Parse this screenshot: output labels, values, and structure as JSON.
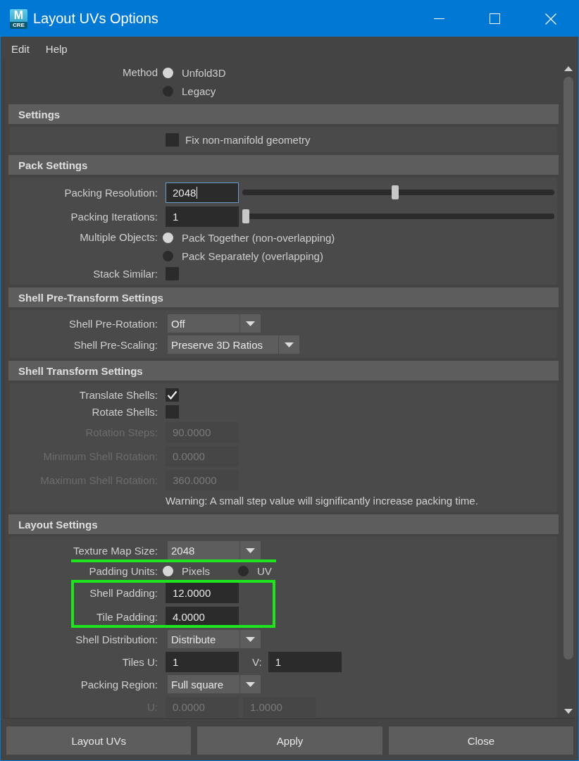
{
  "window": {
    "title": "Layout UVs Options",
    "logo": {
      "letter": "M",
      "badge": "CRE"
    }
  },
  "menu": [
    {
      "label": "Edit"
    },
    {
      "label": "Help"
    }
  ],
  "sections": [
    {
      "rows": [
        {
          "kind": "radio",
          "label": "Method",
          "options": [
            {
              "label": "Unfold3D",
              "selected": true
            },
            {
              "label": "Legacy",
              "selected": false
            }
          ]
        }
      ]
    },
    {
      "title": "Settings",
      "rows": [
        {
          "kind": "checkbox",
          "text": "Fix non-manifold geometry",
          "checked": false
        }
      ]
    },
    {
      "title": "Pack Settings",
      "rows": [
        {
          "kind": "slider",
          "label": "Packing Resolution:",
          "value": "2048",
          "focused": true,
          "level": 0.49
        },
        {
          "kind": "slider",
          "label": "Packing Iterations:",
          "value": "1",
          "focused": false,
          "level": 0
        },
        {
          "kind": "radio",
          "label": "Multiple Objects:",
          "options": [
            {
              "label": "Pack Together (non-overlapping)",
              "selected": true
            },
            {
              "label": "Pack Separately (overlapping)",
              "selected": false
            }
          ]
        },
        {
          "kind": "checkbox",
          "label": "Stack Similar:",
          "checked": false
        }
      ]
    },
    {
      "title": "Shell Pre-Transform Settings",
      "rows": [
        {
          "kind": "dropdown",
          "label": "Shell Pre-Rotation:",
          "value": "Off"
        },
        {
          "kind": "dropdown",
          "label": "Shell Pre-Scaling:",
          "value": "Preserve 3D Ratios"
        }
      ]
    },
    {
      "title": "Shell Transform Settings",
      "rows": [
        {
          "kind": "checkbox",
          "label": "Translate Shells:",
          "checked": true
        },
        {
          "kind": "checkbox",
          "label": "Rotate Shells:",
          "checked": false
        },
        {
          "kind": "fields",
          "label": "Rotation Steps:",
          "disabled": true,
          "fields": [
            {
              "value": "90.0000"
            }
          ]
        },
        {
          "kind": "fields",
          "label": "Minimum Shell Rotation:",
          "disabled": true,
          "fields": [
            {
              "value": "0.0000"
            }
          ]
        },
        {
          "kind": "fields",
          "label": "Maximum Shell Rotation:",
          "disabled": true,
          "fields": [
            {
              "value": "360.0000"
            }
          ]
        },
        {
          "kind": "note",
          "text": "Warning: A small step value will significantly increase packing time."
        }
      ]
    },
    {
      "title": "Layout Settings",
      "rows": [
        {
          "kind": "dropdown",
          "label": "Texture Map Size:",
          "value": "2048",
          "underlined": true
        },
        {
          "kind": "radio_inline",
          "label": "Padding Units:",
          "underlined": false,
          "options": [
            {
              "label": "Pixels",
              "selected": true
            },
            {
              "label": "UV",
              "selected": false
            }
          ]
        },
        {
          "kind": "group",
          "highlighted": true,
          "underlined": false,
          "rows": [
            {
              "kind": "fields",
              "label": "Shell Padding:",
              "disabled": false,
              "fields": [
                {
                  "value": "12.0000"
                }
              ]
            },
            {
              "kind": "fields",
              "label": "Tile Padding:",
              "disabled": false,
              "fields": [
                {
                  "value": "4.0000"
                }
              ]
            }
          ]
        },
        {
          "kind": "dropdown",
          "label": "Shell Distribution:",
          "value": "Distribute",
          "underlined": false
        },
        {
          "kind": "fields",
          "label": "Tiles U:",
          "disabled": false,
          "underlined": false,
          "fields": [
            {
              "value": "1"
            },
            {
              "label": "V:",
              "value": "1"
            }
          ]
        },
        {
          "kind": "dropdown",
          "label": "Packing Region:",
          "value": "Full square",
          "underlined": false
        },
        {
          "kind": "fields",
          "label": "U:",
          "disabled": true,
          "underlined": false,
          "fields": [
            {
              "value": "0.0000"
            },
            {
              "value": "1.0000"
            }
          ]
        }
      ]
    }
  ],
  "buttons": [
    {
      "label": "Layout UVs"
    },
    {
      "label": "Apply"
    },
    {
      "label": "Close"
    }
  ]
}
